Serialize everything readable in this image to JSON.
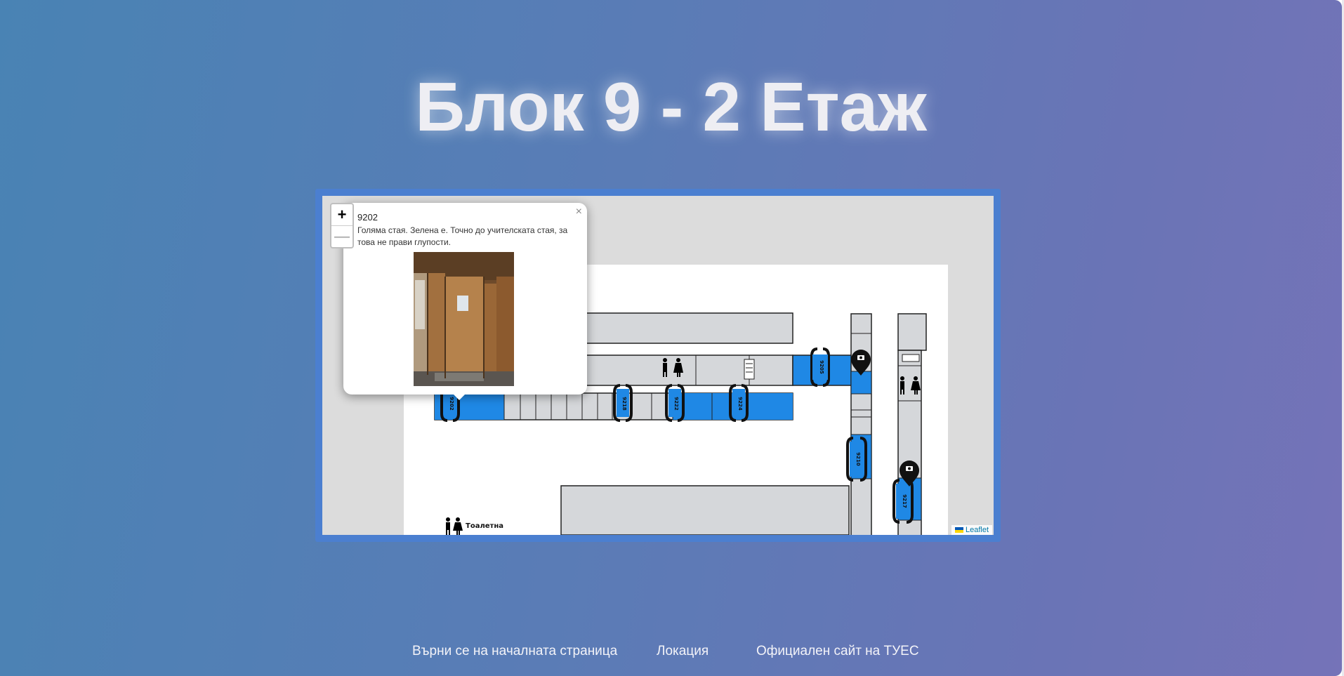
{
  "page": {
    "title": "Блок 9 - 2 Етаж"
  },
  "map": {
    "zoom_in": "+",
    "zoom_out": "—",
    "attribution": "Leaflet",
    "popup": {
      "title": "9202",
      "description": "Голяма стая. Зелена е. Точно до учителската стая, за това не прави глупости.",
      "close": "×"
    },
    "room_labels": [
      "9202",
      "9218",
      "9222",
      "9224",
      "9205",
      "9210",
      "9217"
    ],
    "restroom_label": "Тоалетна",
    "colors": {
      "room_highlight": "#1f88e5",
      "room_default": "#d5d7da",
      "frame": "#4b7fd0"
    },
    "icons": [
      "camera-marker-icon",
      "restroom-icon",
      "stairs-icon"
    ]
  },
  "footer": {
    "home": "Върни се на началната страница",
    "location": "Локация",
    "official": "Официален сайт на ТУЕС"
  }
}
